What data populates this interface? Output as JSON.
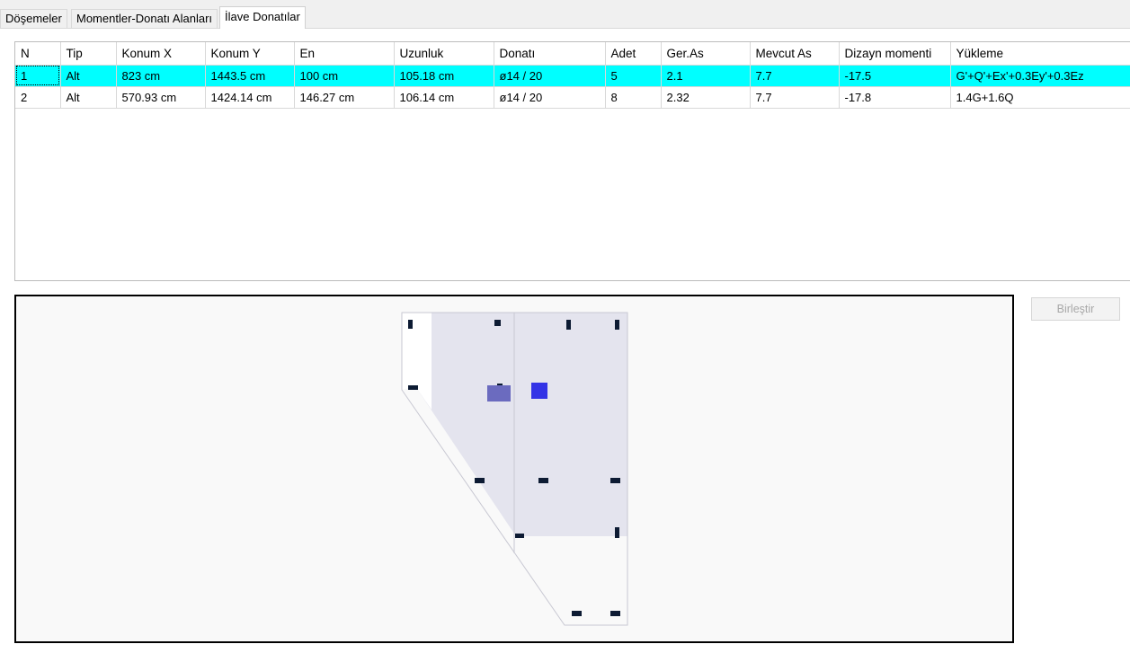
{
  "tabs": [
    {
      "label": "Döşemeler"
    },
    {
      "label": "Momentler-Donatı Alanları"
    },
    {
      "label": "İlave Donatılar",
      "active": true
    }
  ],
  "table": {
    "headers": [
      "N",
      "Tip",
      "Konum X",
      "Konum Y",
      "En",
      "Uzunluk",
      "Donatı",
      "Adet",
      "Ger.As",
      "Mevcut As",
      "Dizayn momenti",
      "Yükleme"
    ],
    "rows": [
      {
        "selected": true,
        "cells": [
          "1",
          "Alt",
          "823 cm",
          "1443.5 cm",
          "100 cm",
          "105.18 cm",
          "ø14 / 20",
          "5",
          "2.1",
          "7.7",
          "-17.5",
          "G'+Q'+Ex'+0.3Ey'+0.3Ez"
        ]
      },
      {
        "selected": false,
        "cells": [
          "2",
          "Alt",
          "570.93 cm",
          "1424.14 cm",
          "146.27 cm",
          "106.14 cm",
          "ø14 / 20",
          "8",
          "2.32",
          "7.7",
          "-17.8",
          "1.4G+1.6Q"
        ]
      }
    ]
  },
  "actions": {
    "merge_label": "Birleştir",
    "merge_enabled": false
  },
  "drawing": {
    "colors": {
      "slab_fill": "#e4e4ee",
      "outline": "#c8c8d2",
      "column": "#0d1b33",
      "rebar_selected": "#3333e6",
      "rebar_other": "#6b6bbf",
      "background": "#f9f9f9"
    }
  }
}
